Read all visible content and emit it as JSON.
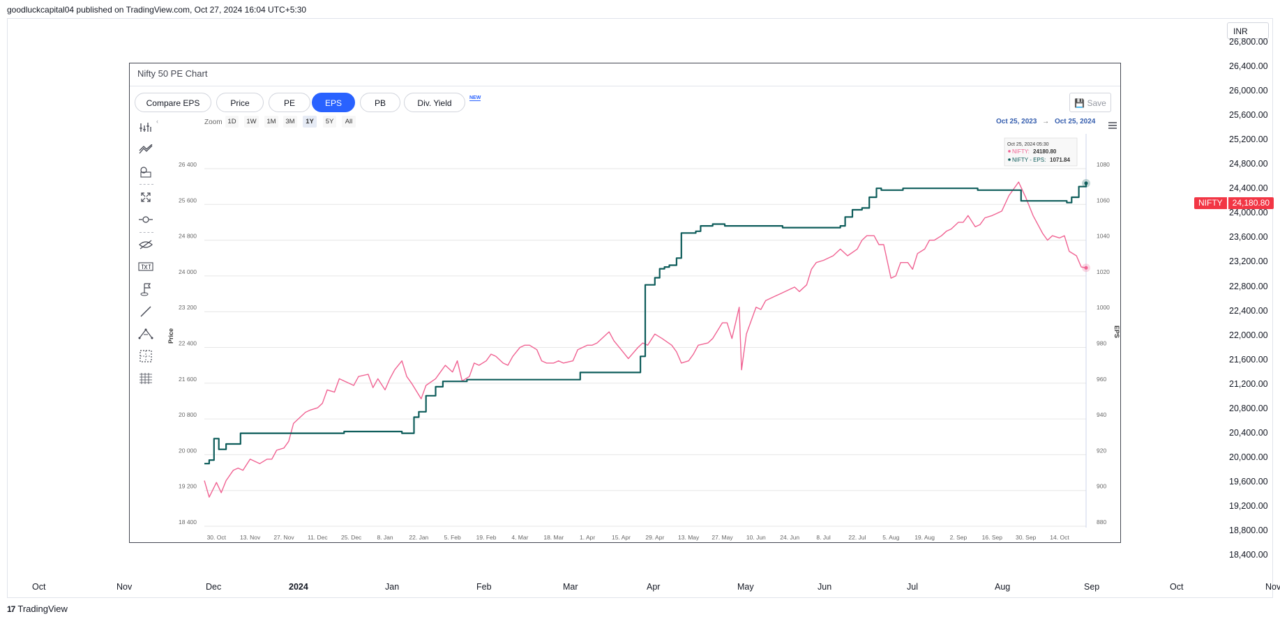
{
  "header": {
    "published_text": "goodluckcapital04 published on TradingView.com, Oct 27, 2024 16:04 UTC+5:30"
  },
  "currency": "INR",
  "right_axis_labels": [
    "26,800.00",
    "26,400.00",
    "26,000.00",
    "25,600.00",
    "25,200.00",
    "24,800.00",
    "24,400.00",
    "24,000.00",
    "23,600.00",
    "23,200.00",
    "22,800.00",
    "22,400.00",
    "22,000.00",
    "21,600.00",
    "21,200.00",
    "20,800.00",
    "20,400.00",
    "20,000.00",
    "19,600.00",
    "19,200.00",
    "18,800.00",
    "18,400.00"
  ],
  "price_tag": {
    "symbol": "NIFTY",
    "value": "24,180.80",
    "color": "#f23645"
  },
  "bottom_months": [
    "Oct",
    "Nov",
    "Dec",
    "2024",
    "Jan",
    "Feb",
    "Mar",
    "Apr",
    "May",
    "Jun",
    "Jul",
    "Aug",
    "Sep",
    "Oct",
    "Nov"
  ],
  "footer": {
    "brand": "TradingView",
    "mark": "17"
  },
  "widget": {
    "title": "Nifty 50 PE Chart",
    "tabs": [
      "Compare EPS",
      "Price",
      "PE",
      "EPS",
      "PB",
      "Div. Yield"
    ],
    "active_tab": "EPS",
    "new_badge": "NEW",
    "save_label": "Save",
    "zoom_label": "Zoom",
    "zoom_buttons": [
      "1D",
      "1W",
      "1M",
      "3M",
      "1Y",
      "5Y",
      "All"
    ],
    "zoom_active": "1Y",
    "range_from": "Oct 25, 2023",
    "range_arrow": "→",
    "range_to": "Oct 25, 2024",
    "tooltip": {
      "date": "Oct 25, 2024 05:30",
      "nifty_label": "NIFTY:",
      "nifty_value": "24180.80",
      "eps_label": "NIFTY - EPS:",
      "eps_value": "1071.84"
    },
    "tools": [
      "line-tool-icon",
      "trend-lines-icon",
      "measure-icon",
      "fullscreen-icon",
      "zoom-icon",
      "hide-icon",
      "text-icon",
      "flag-icon",
      "draw-line-icon",
      "path-icon",
      "selection-icon",
      "grid-icon"
    ]
  },
  "chart_data": {
    "type": "line",
    "left_axis_title": "Price",
    "right_axis_title": "EPS",
    "left_axis_ticks": [
      18400,
      19200,
      20000,
      20800,
      21600,
      22400,
      23200,
      24000,
      24800,
      25600,
      26400
    ],
    "left_axis_tick_labels": [
      "18 400",
      "19 200",
      "20 000",
      "20 800",
      "21 600",
      "22 400",
      "23 200",
      "24 000",
      "24 800",
      "25 600",
      "26 400"
    ],
    "right_axis_ticks": [
      880,
      900,
      920,
      940,
      960,
      980,
      1000,
      1020,
      1040,
      1060,
      1080
    ],
    "x_tick_labels": [
      "30. Oct",
      "13. Nov",
      "27. Nov",
      "11. Dec",
      "25. Dec",
      "8. Jan",
      "22. Jan",
      "5. Feb",
      "19. Feb",
      "4. Mar",
      "18. Mar",
      "1. Apr",
      "15. Apr",
      "29. Apr",
      "13. May",
      "27. May",
      "10. Jun",
      "24. Jun",
      "8. Jul",
      "22. Jul",
      "5. Aug",
      "19. Aug",
      "2. Sep",
      "16. Sep",
      "30. Sep",
      "14. Oct"
    ],
    "x_range": [
      "2023-10-25",
      "2024-10-25"
    ],
    "series": [
      {
        "name": "NIFTY",
        "color": "#f06292",
        "axis": "left",
        "x": [
          "2023-10-25",
          "2023-10-27",
          "2023-10-30",
          "2023-11-01",
          "2023-11-03",
          "2023-11-06",
          "2023-11-08",
          "2023-11-10",
          "2023-11-13",
          "2023-11-15",
          "2023-11-17",
          "2023-11-20",
          "2023-11-22",
          "2023-11-24",
          "2023-11-27",
          "2023-11-29",
          "2023-12-01",
          "2023-12-04",
          "2023-12-06",
          "2023-12-08",
          "2023-12-11",
          "2023-12-13",
          "2023-12-15",
          "2023-12-18",
          "2023-12-20",
          "2023-12-22",
          "2023-12-26",
          "2023-12-28",
          "2024-01-01",
          "2024-01-03",
          "2024-01-05",
          "2024-01-08",
          "2024-01-10",
          "2024-01-12",
          "2024-01-15",
          "2024-01-17",
          "2024-01-19",
          "2024-01-23",
          "2024-01-25",
          "2024-01-29",
          "2024-01-31",
          "2024-02-02",
          "2024-02-05",
          "2024-02-07",
          "2024-02-09",
          "2024-02-12",
          "2024-02-14",
          "2024-02-16",
          "2024-02-19",
          "2024-02-21",
          "2024-02-23",
          "2024-02-26",
          "2024-02-28",
          "2024-03-01",
          "2024-03-04",
          "2024-03-06",
          "2024-03-08",
          "2024-03-11",
          "2024-03-13",
          "2024-03-15",
          "2024-03-18",
          "2024-03-20",
          "2024-03-22",
          "2024-03-26",
          "2024-03-28",
          "2024-04-01",
          "2024-04-03",
          "2024-04-05",
          "2024-04-08",
          "2024-04-10",
          "2024-04-12",
          "2024-04-15",
          "2024-04-18",
          "2024-04-22",
          "2024-04-24",
          "2024-04-26",
          "2024-04-29",
          "2024-05-02",
          "2024-05-06",
          "2024-05-08",
          "2024-05-10",
          "2024-05-13",
          "2024-05-15",
          "2024-05-17",
          "2024-05-21",
          "2024-05-23",
          "2024-05-27",
          "2024-05-29",
          "2024-05-31",
          "2024-06-03",
          "2024-06-04",
          "2024-06-06",
          "2024-06-10",
          "2024-06-12",
          "2024-06-14",
          "2024-06-18",
          "2024-06-20",
          "2024-06-24",
          "2024-06-26",
          "2024-06-28",
          "2024-07-01",
          "2024-07-03",
          "2024-07-05",
          "2024-07-08",
          "2024-07-10",
          "2024-07-12",
          "2024-07-15",
          "2024-07-18",
          "2024-07-22",
          "2024-07-24",
          "2024-07-26",
          "2024-07-29",
          "2024-07-31",
          "2024-08-02",
          "2024-08-05",
          "2024-08-07",
          "2024-08-09",
          "2024-08-12",
          "2024-08-14",
          "2024-08-16",
          "2024-08-19",
          "2024-08-21",
          "2024-08-23",
          "2024-08-26",
          "2024-08-28",
          "2024-08-30",
          "2024-09-02",
          "2024-09-04",
          "2024-09-06",
          "2024-09-09",
          "2024-09-11",
          "2024-09-13",
          "2024-09-16",
          "2024-09-18",
          "2024-09-20",
          "2024-09-23",
          "2024-09-25",
          "2024-09-27",
          "2024-09-30",
          "2024-10-03",
          "2024-10-07",
          "2024-10-09",
          "2024-10-11",
          "2024-10-14",
          "2024-10-16",
          "2024-10-18",
          "2024-10-21",
          "2024-10-23",
          "2024-10-25"
        ],
        "values": [
          19420,
          19050,
          19380,
          19150,
          19420,
          19650,
          19700,
          19650,
          19900,
          19850,
          19800,
          19900,
          19900,
          20100,
          20150,
          20300,
          20700,
          20850,
          20950,
          21000,
          21050,
          21150,
          21450,
          21400,
          21700,
          21650,
          21550,
          21750,
          21800,
          21500,
          21700,
          21450,
          21700,
          21900,
          22100,
          21750,
          21600,
          21250,
          21550,
          21700,
          21850,
          22000,
          21850,
          22100,
          21650,
          21750,
          22050,
          22000,
          22100,
          22250,
          22200,
          22050,
          22000,
          22200,
          22400,
          22450,
          22450,
          22350,
          22100,
          22050,
          22050,
          22100,
          22050,
          22100,
          22350,
          22450,
          22450,
          22500,
          22650,
          22750,
          22550,
          22350,
          22150,
          22400,
          22500,
          22450,
          22700,
          22600,
          22450,
          22300,
          22050,
          22100,
          22250,
          22450,
          22500,
          22600,
          22950,
          22950,
          22600,
          23300,
          21900,
          22700,
          23300,
          23250,
          23450,
          23550,
          23600,
          23700,
          23750,
          23650,
          23800,
          24150,
          24300,
          24350,
          24400,
          24450,
          24600,
          24450,
          24600,
          24800,
          24900,
          24900,
          24700,
          24700,
          23950,
          24000,
          24300,
          24300,
          24150,
          24500,
          24600,
          24800,
          24800,
          24900,
          25000,
          25050,
          25200,
          25200,
          25350,
          25100,
          25150,
          25300,
          25350,
          25400,
          25450,
          25800,
          25950,
          26100,
          25750,
          25350,
          24950,
          24800,
          24900,
          24850,
          24900,
          24550,
          24450,
          24200,
          24180.8
        ]
      },
      {
        "name": "NIFTY - EPS",
        "color": "#0d5c5a",
        "axis": "right",
        "x": [
          "2023-10-25",
          "2023-10-27",
          "2023-10-29",
          "2023-10-31",
          "2023-11-03",
          "2023-11-06",
          "2023-11-09",
          "2023-11-13",
          "2023-11-15",
          "2023-11-17",
          "2023-11-21",
          "2023-11-24",
          "2023-11-28",
          "2023-12-01",
          "2023-12-08",
          "2023-12-15",
          "2023-12-22",
          "2023-12-29",
          "2024-01-01",
          "2024-01-08",
          "2024-01-15",
          "2024-01-18",
          "2024-01-20",
          "2024-01-22",
          "2024-01-25",
          "2024-01-29",
          "2024-02-01",
          "2024-02-03",
          "2024-02-07",
          "2024-02-11",
          "2024-02-14",
          "2024-02-16",
          "2024-02-18",
          "2024-02-21",
          "2024-03-01",
          "2024-03-15",
          "2024-03-27",
          "2024-03-29",
          "2024-04-10",
          "2024-04-20",
          "2024-04-23",
          "2024-04-25",
          "2024-04-29",
          "2024-05-01",
          "2024-05-03",
          "2024-05-05",
          "2024-05-08",
          "2024-05-10",
          "2024-05-13",
          "2024-05-16",
          "2024-05-18",
          "2024-05-23",
          "2024-05-28",
          "2024-06-01",
          "2024-06-15",
          "2024-06-21",
          "2024-06-28",
          "2024-07-15",
          "2024-07-17",
          "2024-07-20",
          "2024-07-24",
          "2024-07-27",
          "2024-07-30",
          "2024-08-01",
          "2024-08-05",
          "2024-08-10",
          "2024-08-20",
          "2024-09-10",
          "2024-09-26",
          "2024-09-28",
          "2024-10-05",
          "2024-10-17",
          "2024-10-19",
          "2024-10-22",
          "2024-10-25"
        ],
        "values": [
          915,
          917,
          929,
          923,
          926,
          926,
          932,
          932,
          932,
          932,
          932,
          932,
          932,
          932,
          932,
          932,
          933,
          933,
          933,
          933,
          932,
          932,
          941,
          944,
          953,
          958,
          961,
          961,
          961,
          962,
          962,
          962,
          962,
          962,
          962,
          962,
          962,
          966,
          966,
          966,
          975,
          1015,
          1019,
          1024,
          1025,
          1026,
          1030,
          1044,
          1044,
          1045,
          1048,
          1049,
          1048,
          1048,
          1048,
          1047,
          1047,
          1048,
          1053,
          1057,
          1058,
          1064,
          1069,
          1068,
          1068,
          1069,
          1069,
          1068,
          1068,
          1062,
          1062,
          1061,
          1064,
          1070,
          1071.84
        ]
      }
    ]
  }
}
